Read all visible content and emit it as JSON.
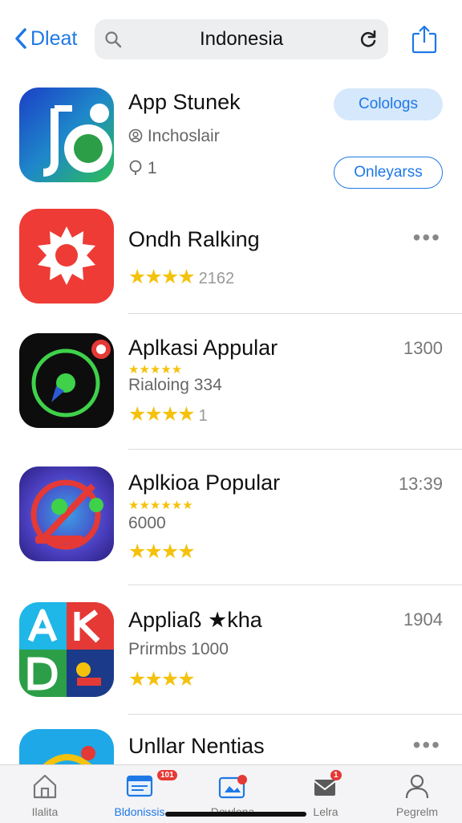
{
  "header": {
    "back_label": "Dleat",
    "search_text": "Indonesia"
  },
  "featured": {
    "title": "App Stunek",
    "developer": "Inchoslair",
    "count": "1",
    "primary_button": "Colologs",
    "secondary_button": "Onleyarss"
  },
  "apps": [
    {
      "title": "Ondh Ralking",
      "rating_count": "2162",
      "more": "•••"
    },
    {
      "title": "Aplkasi Appular",
      "subtitle": "Rialoing 334",
      "right_value": "1300",
      "rating_count": "1"
    },
    {
      "title": "Aplkioa Popular",
      "subtitle": "6000",
      "right_value": "13:39"
    },
    {
      "title": "Appliaß ★kha",
      "subtitle": "Prirmbs 1000",
      "right_value": "1904"
    },
    {
      "title": "Unllar Nentias",
      "more": "•••"
    }
  ],
  "tabs": [
    {
      "label": "Ilalita"
    },
    {
      "label": "Bldonissis",
      "badge": "101"
    },
    {
      "label": "Dowlona"
    },
    {
      "label": "Lelra",
      "badge": "1"
    },
    {
      "label": "Pegrelm"
    }
  ],
  "colors": {
    "accent": "#1e78e6",
    "star": "#f4c20d",
    "badge": "#e53935"
  }
}
